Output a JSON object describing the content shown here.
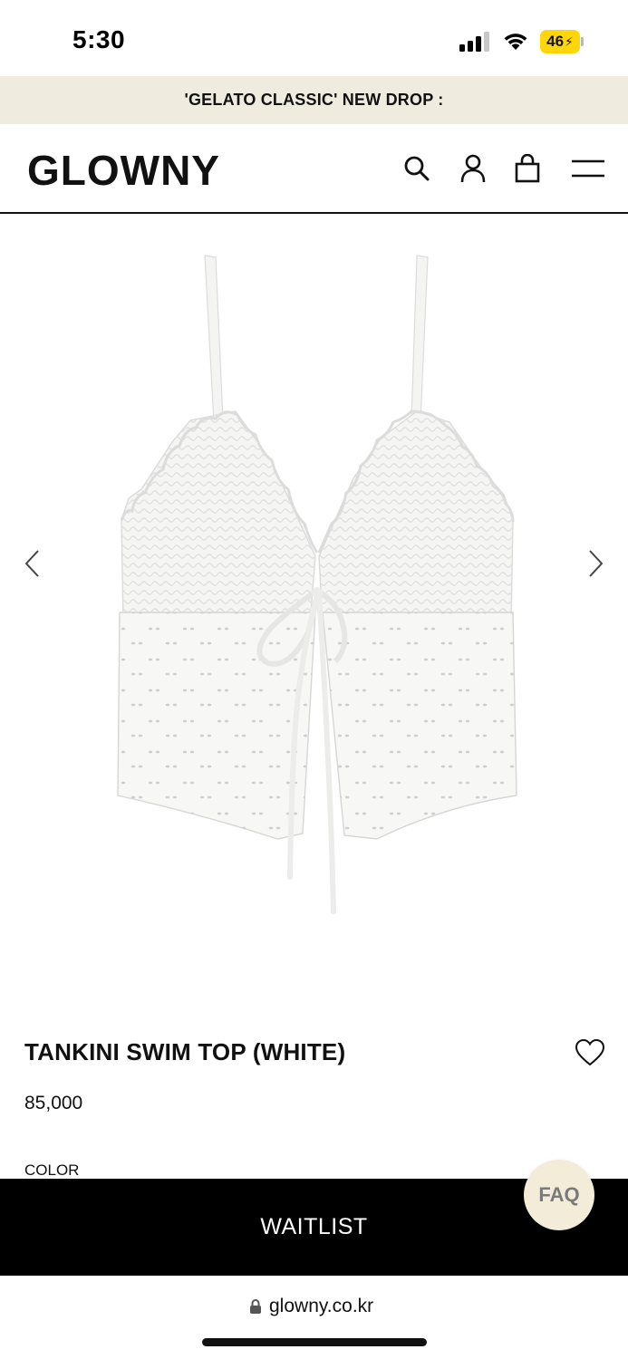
{
  "status_bar": {
    "time": "5:30",
    "battery": "46",
    "icons": [
      "signal-icon",
      "wifi-icon",
      "battery-icon"
    ]
  },
  "announcement": {
    "text": "'GELATO CLASSIC' NEW DROP :"
  },
  "header": {
    "logo": "GLOWNY",
    "icons": [
      "search-icon",
      "user-icon",
      "shopping-bag-icon",
      "menu-icon"
    ]
  },
  "gallery": {
    "prev_icon": "chevron-left-icon",
    "next_icon": "chevron-right-icon"
  },
  "product": {
    "name": "TANKINI SWIM TOP (WHITE)",
    "price": "85,000",
    "color_label": "COLOR",
    "wishlist_icon": "heart-icon"
  },
  "actions": {
    "waitlist_label": "WAITLIST",
    "faq_label": "FAQ"
  },
  "browser": {
    "url": "glowny.co.kr",
    "lock_icon": "lock-icon"
  },
  "colors": {
    "announcement_bg": "#f0ebdf",
    "waitlist_bg": "#000000",
    "faq_bg": "#f3ecd9",
    "battery": "#ffd60a"
  }
}
